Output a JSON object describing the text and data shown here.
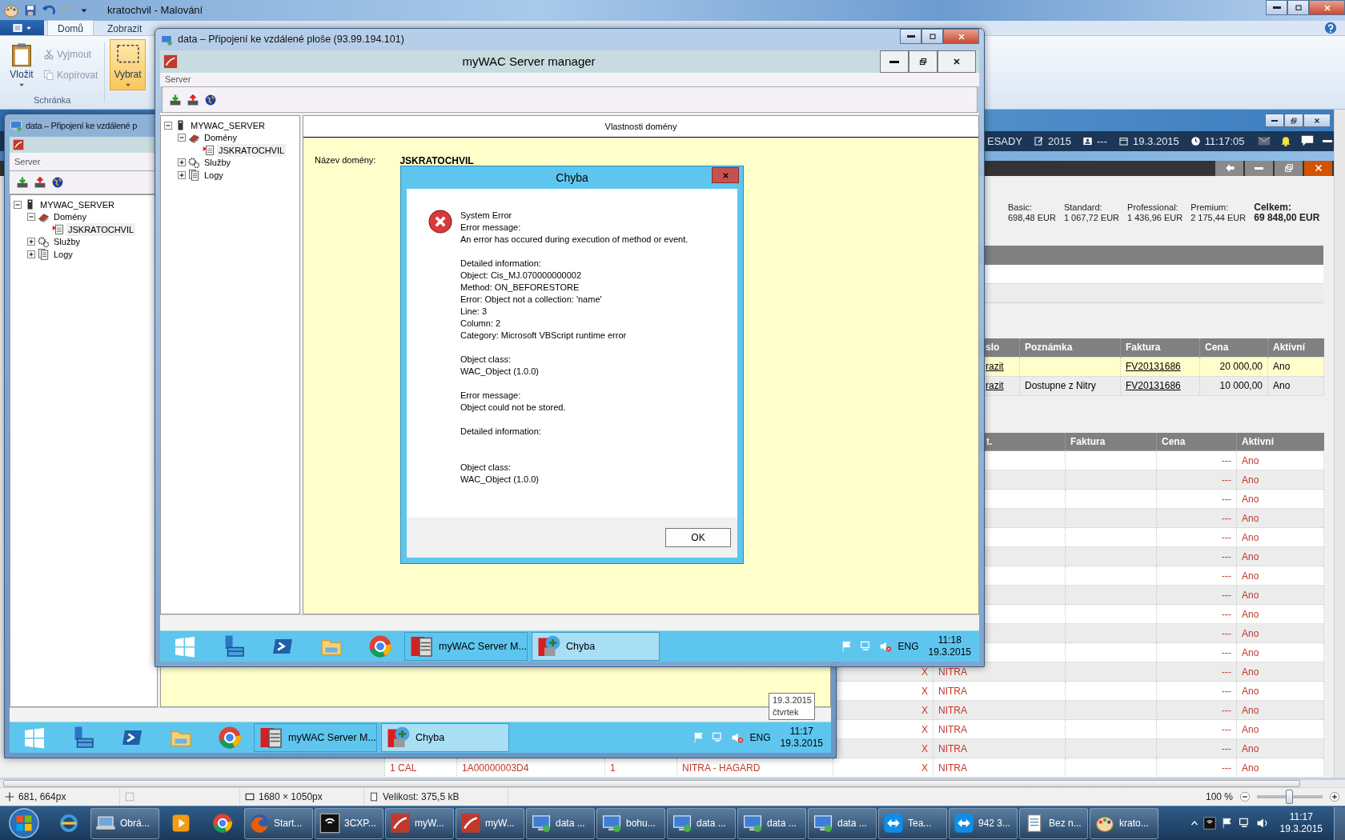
{
  "paint": {
    "title": "kratochvil - Malování",
    "tabs": [
      {
        "label": "Domů",
        "selected": true
      },
      {
        "label": "Zobrazit",
        "selected": false
      }
    ],
    "clipboard": {
      "paste": "Vložit",
      "cut": "Vyjmout",
      "copy": "Kopírovat",
      "group": "Schránka"
    },
    "select_tool": {
      "label": "Vybrat",
      "selected": true
    },
    "status_bar": {
      "cursor": "681, 664px",
      "dimensions": "1680 × 1050px",
      "file_size": "Velikost: 375,5 kB",
      "zoom": "100 %"
    },
    "zoom_slider": {
      "level": 0.5
    }
  },
  "web_app": {
    "toolbar": [
      {
        "label": "ESADY"
      },
      {
        "label": "2015"
      },
      {
        "label": "---"
      },
      {
        "label": "19.3.2015"
      },
      {
        "label": "11:17:05"
      }
    ],
    "summary": [
      {
        "label": "Basic:",
        "value": "698,48 EUR",
        "kind": "plan"
      },
      {
        "label": "Standard:",
        "value": "1 067,72 EUR",
        "kind": "plan"
      },
      {
        "label": "Professional:",
        "value": "1 436,96 EUR",
        "kind": "plan"
      },
      {
        "label": "Premium:",
        "value": "2 175,44 EUR",
        "kind": "plan"
      },
      {
        "label": "Celkem:",
        "value": "69 848,00 EUR",
        "kind": "total"
      }
    ],
    "table_1": {
      "columns": [
        "slo",
        "Poznámka",
        "Faktura",
        "Cena",
        "Aktivní"
      ],
      "rows": [
        {
          "selected": true,
          "column_1": "razit",
          "invoice": "FV20131686",
          "price": "20 000,00",
          "active": "Ano"
        },
        {
          "selected": false,
          "column_1": "razit",
          "note": "Dostupne z Nitry",
          "invoice": "FV20131686",
          "price": "10 000,00",
          "active": "Ano"
        }
      ]
    },
    "table_2": {
      "columns": [
        "t.",
        "Faktura",
        "Cena",
        "Aktivní"
      ],
      "rows": [
        {
          "price": "---",
          "active": "Ano"
        },
        {
          "price": "---",
          "active": "Ano"
        },
        {
          "price": "---",
          "active": "Ano"
        },
        {
          "price": "---",
          "active": "Ano"
        },
        {
          "price": "---",
          "active": "Ano"
        },
        {
          "price": "---",
          "active": "Ano"
        },
        {
          "price": "---",
          "active": "Ano"
        },
        {
          "price": "---",
          "active": "Ano"
        },
        {
          "price": "---",
          "active": "Ano"
        },
        {
          "price": "---",
          "active": "Ano"
        },
        {
          "price": "---",
          "active": "Ano"
        },
        {
          "column_6": "X",
          "column_7": "NITRA",
          "price": "---",
          "active": "Ano"
        },
        {
          "column_6": "X",
          "column_7": "NITRA",
          "price": "---",
          "active": "Ano"
        },
        {
          "column_6": "X",
          "column_7": "NITRA",
          "price": "---",
          "active": "Ano"
        },
        {
          "column_6": "X",
          "column_7": "NITRA",
          "price": "---",
          "active": "Ano"
        },
        {
          "column_6": "X",
          "column_7": "NITRA",
          "price": "---",
          "active": "Ano"
        },
        {
          "column_2": "1 CAL",
          "column_3": "1A00000003D4",
          "column_4": "1",
          "column_5": "NITRA - HAGARD",
          "column_6": "X",
          "column_7": "NITRA",
          "price": "---",
          "active": "Ano"
        }
      ]
    }
  },
  "remote_front": {
    "title": "data – Připojení ke vzdálené ploše (93.99.194.101)",
    "app_title": "myWAC Server manager",
    "menu": [
      "Server"
    ],
    "tree": [
      {
        "label": "MYWAC_SERVER",
        "expanded": true,
        "selected": false,
        "children": [
          {
            "label": "Domény",
            "expanded": true,
            "selected": false,
            "children": [
              {
                "label": "JSKRATOCHVIL",
                "selected": true
              }
            ]
          },
          {
            "label": "Služby",
            "expanded": false,
            "selected": false
          },
          {
            "label": "Logy",
            "expanded": false,
            "selected": false
          }
        ]
      }
    ],
    "panel_title": "Vlastnosti domény",
    "domain_label": "Název domény:",
    "domain_value": "JSKRATOCHVIL",
    "dialog": {
      "title": "Chyba",
      "paragraphs": [
        {
          "lines": [
            "System Error",
            "Error message:",
            "An error has occured during execution of method or event."
          ]
        },
        {
          "lines": [
            "Detailed information:",
            "Object: Cis_MJ.070000000002",
            "Method: ON_BEFORESTORE",
            "Error: Object not a collection: 'name'",
            "Line: 3",
            "Column: 2",
            "Category: Microsoft VBScript runtime error"
          ]
        },
        {
          "lines": [
            "Object class:",
            "WAC_Object (1.0.0)"
          ]
        },
        {
          "lines": [
            "Error message:",
            "Object could not be stored."
          ]
        },
        {
          "lines": [
            "Detailed information:"
          ]
        },
        {
          "lines": [
            "Object class:",
            "WAC_Object (1.0.0)"
          ]
        }
      ],
      "button": "OK"
    },
    "taskbar": {
      "windows": [
        {
          "label": "myWAC Server M...",
          "selected": false
        },
        {
          "label": "Chyba",
          "selected": true
        }
      ],
      "language": "ENG",
      "time": "11:18",
      "date": "19.3.2015"
    }
  },
  "remote_back": {
    "title": "data – Připojení ke vzdálené p",
    "menu": [
      "Server"
    ],
    "tree": [
      {
        "label": "MYWAC_SERVER",
        "expanded": true,
        "selected": false,
        "children": [
          {
            "label": "Domény",
            "expanded": true,
            "selected": false,
            "children": [
              {
                "label": "JSKRATOCHVIL",
                "selected": true
              }
            ]
          },
          {
            "label": "Služby",
            "expanded": false,
            "selected": false
          },
          {
            "label": "Logy",
            "expanded": false,
            "selected": false
          }
        ]
      }
    ],
    "taskbar": {
      "windows": [
        {
          "label": "myWAC Server M...",
          "selected": false
        },
        {
          "label": "Chyba",
          "selected": true
        }
      ],
      "language": "ENG",
      "time": "11:17",
      "date": "19.3.2015"
    },
    "tooltip": {
      "date": "19.3.2015",
      "day": "čtvrtek"
    }
  },
  "taskbar": {
    "items": [
      {
        "pinned": true
      },
      {
        "label": "Obrá...",
        "pinned": false
      },
      {
        "pinned": true
      },
      {
        "pinned": true
      },
      {
        "label": "Start...",
        "pinned": false
      },
      {
        "label": "3CXP...",
        "pinned": false
      },
      {
        "label": "myW...",
        "pinned": false
      },
      {
        "label": "myW...",
        "pinned": false
      },
      {
        "label": "data ...",
        "pinned": false
      },
      {
        "label": "bohu...",
        "pinned": false
      },
      {
        "label": "data ...",
        "pinned": false
      },
      {
        "label": "data ...",
        "pinned": false
      },
      {
        "label": "data ...",
        "pinned": false
      },
      {
        "label": "Tea...",
        "pinned": false
      },
      {
        "label": "942 3...",
        "pinned": false
      },
      {
        "label": "Bez n...",
        "pinned": false
      },
      {
        "label": "krato...",
        "pinned": false
      }
    ],
    "time": "11:17",
    "date": "19.3.2015"
  }
}
